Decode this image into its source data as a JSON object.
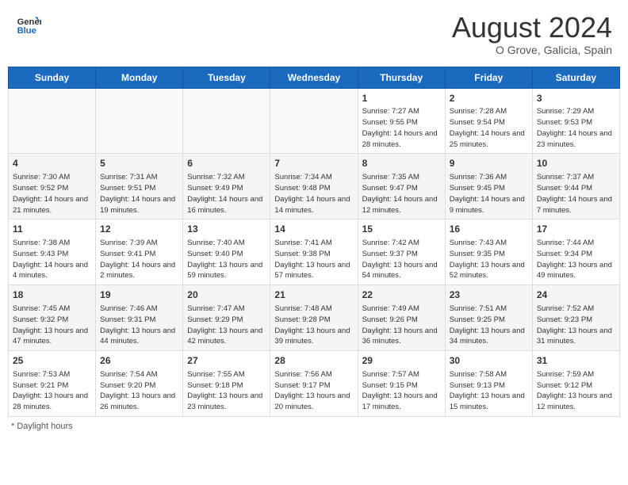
{
  "header": {
    "logo_general": "General",
    "logo_blue": "Blue",
    "month_year": "August 2024",
    "location": "O Grove, Galicia, Spain"
  },
  "days_of_week": [
    "Sunday",
    "Monday",
    "Tuesday",
    "Wednesday",
    "Thursday",
    "Friday",
    "Saturday"
  ],
  "weeks": [
    [
      {
        "day": null
      },
      {
        "day": null
      },
      {
        "day": null
      },
      {
        "day": null
      },
      {
        "day": 1,
        "sunrise": "Sunrise: 7:27 AM",
        "sunset": "Sunset: 9:55 PM",
        "daylight": "Daylight: 14 hours and 28 minutes."
      },
      {
        "day": 2,
        "sunrise": "Sunrise: 7:28 AM",
        "sunset": "Sunset: 9:54 PM",
        "daylight": "Daylight: 14 hours and 25 minutes."
      },
      {
        "day": 3,
        "sunrise": "Sunrise: 7:29 AM",
        "sunset": "Sunset: 9:53 PM",
        "daylight": "Daylight: 14 hours and 23 minutes."
      }
    ],
    [
      {
        "day": 4,
        "sunrise": "Sunrise: 7:30 AM",
        "sunset": "Sunset: 9:52 PM",
        "daylight": "Daylight: 14 hours and 21 minutes."
      },
      {
        "day": 5,
        "sunrise": "Sunrise: 7:31 AM",
        "sunset": "Sunset: 9:51 PM",
        "daylight": "Daylight: 14 hours and 19 minutes."
      },
      {
        "day": 6,
        "sunrise": "Sunrise: 7:32 AM",
        "sunset": "Sunset: 9:49 PM",
        "daylight": "Daylight: 14 hours and 16 minutes."
      },
      {
        "day": 7,
        "sunrise": "Sunrise: 7:34 AM",
        "sunset": "Sunset: 9:48 PM",
        "daylight": "Daylight: 14 hours and 14 minutes."
      },
      {
        "day": 8,
        "sunrise": "Sunrise: 7:35 AM",
        "sunset": "Sunset: 9:47 PM",
        "daylight": "Daylight: 14 hours and 12 minutes."
      },
      {
        "day": 9,
        "sunrise": "Sunrise: 7:36 AM",
        "sunset": "Sunset: 9:45 PM",
        "daylight": "Daylight: 14 hours and 9 minutes."
      },
      {
        "day": 10,
        "sunrise": "Sunrise: 7:37 AM",
        "sunset": "Sunset: 9:44 PM",
        "daylight": "Daylight: 14 hours and 7 minutes."
      }
    ],
    [
      {
        "day": 11,
        "sunrise": "Sunrise: 7:38 AM",
        "sunset": "Sunset: 9:43 PM",
        "daylight": "Daylight: 14 hours and 4 minutes."
      },
      {
        "day": 12,
        "sunrise": "Sunrise: 7:39 AM",
        "sunset": "Sunset: 9:41 PM",
        "daylight": "Daylight: 14 hours and 2 minutes."
      },
      {
        "day": 13,
        "sunrise": "Sunrise: 7:40 AM",
        "sunset": "Sunset: 9:40 PM",
        "daylight": "Daylight: 13 hours and 59 minutes."
      },
      {
        "day": 14,
        "sunrise": "Sunrise: 7:41 AM",
        "sunset": "Sunset: 9:38 PM",
        "daylight": "Daylight: 13 hours and 57 minutes."
      },
      {
        "day": 15,
        "sunrise": "Sunrise: 7:42 AM",
        "sunset": "Sunset: 9:37 PM",
        "daylight": "Daylight: 13 hours and 54 minutes."
      },
      {
        "day": 16,
        "sunrise": "Sunrise: 7:43 AM",
        "sunset": "Sunset: 9:35 PM",
        "daylight": "Daylight: 13 hours and 52 minutes."
      },
      {
        "day": 17,
        "sunrise": "Sunrise: 7:44 AM",
        "sunset": "Sunset: 9:34 PM",
        "daylight": "Daylight: 13 hours and 49 minutes."
      }
    ],
    [
      {
        "day": 18,
        "sunrise": "Sunrise: 7:45 AM",
        "sunset": "Sunset: 9:32 PM",
        "daylight": "Daylight: 13 hours and 47 minutes."
      },
      {
        "day": 19,
        "sunrise": "Sunrise: 7:46 AM",
        "sunset": "Sunset: 9:31 PM",
        "daylight": "Daylight: 13 hours and 44 minutes."
      },
      {
        "day": 20,
        "sunrise": "Sunrise: 7:47 AM",
        "sunset": "Sunset: 9:29 PM",
        "daylight": "Daylight: 13 hours and 42 minutes."
      },
      {
        "day": 21,
        "sunrise": "Sunrise: 7:48 AM",
        "sunset": "Sunset: 9:28 PM",
        "daylight": "Daylight: 13 hours and 39 minutes."
      },
      {
        "day": 22,
        "sunrise": "Sunrise: 7:49 AM",
        "sunset": "Sunset: 9:26 PM",
        "daylight": "Daylight: 13 hours and 36 minutes."
      },
      {
        "day": 23,
        "sunrise": "Sunrise: 7:51 AM",
        "sunset": "Sunset: 9:25 PM",
        "daylight": "Daylight: 13 hours and 34 minutes."
      },
      {
        "day": 24,
        "sunrise": "Sunrise: 7:52 AM",
        "sunset": "Sunset: 9:23 PM",
        "daylight": "Daylight: 13 hours and 31 minutes."
      }
    ],
    [
      {
        "day": 25,
        "sunrise": "Sunrise: 7:53 AM",
        "sunset": "Sunset: 9:21 PM",
        "daylight": "Daylight: 13 hours and 28 minutes."
      },
      {
        "day": 26,
        "sunrise": "Sunrise: 7:54 AM",
        "sunset": "Sunset: 9:20 PM",
        "daylight": "Daylight: 13 hours and 26 minutes."
      },
      {
        "day": 27,
        "sunrise": "Sunrise: 7:55 AM",
        "sunset": "Sunset: 9:18 PM",
        "daylight": "Daylight: 13 hours and 23 minutes."
      },
      {
        "day": 28,
        "sunrise": "Sunrise: 7:56 AM",
        "sunset": "Sunset: 9:17 PM",
        "daylight": "Daylight: 13 hours and 20 minutes."
      },
      {
        "day": 29,
        "sunrise": "Sunrise: 7:57 AM",
        "sunset": "Sunset: 9:15 PM",
        "daylight": "Daylight: 13 hours and 17 minutes."
      },
      {
        "day": 30,
        "sunrise": "Sunrise: 7:58 AM",
        "sunset": "Sunset: 9:13 PM",
        "daylight": "Daylight: 13 hours and 15 minutes."
      },
      {
        "day": 31,
        "sunrise": "Sunrise: 7:59 AM",
        "sunset": "Sunset: 9:12 PM",
        "daylight": "Daylight: 13 hours and 12 minutes."
      }
    ]
  ],
  "footer": {
    "daylight_label": "Daylight hours"
  }
}
